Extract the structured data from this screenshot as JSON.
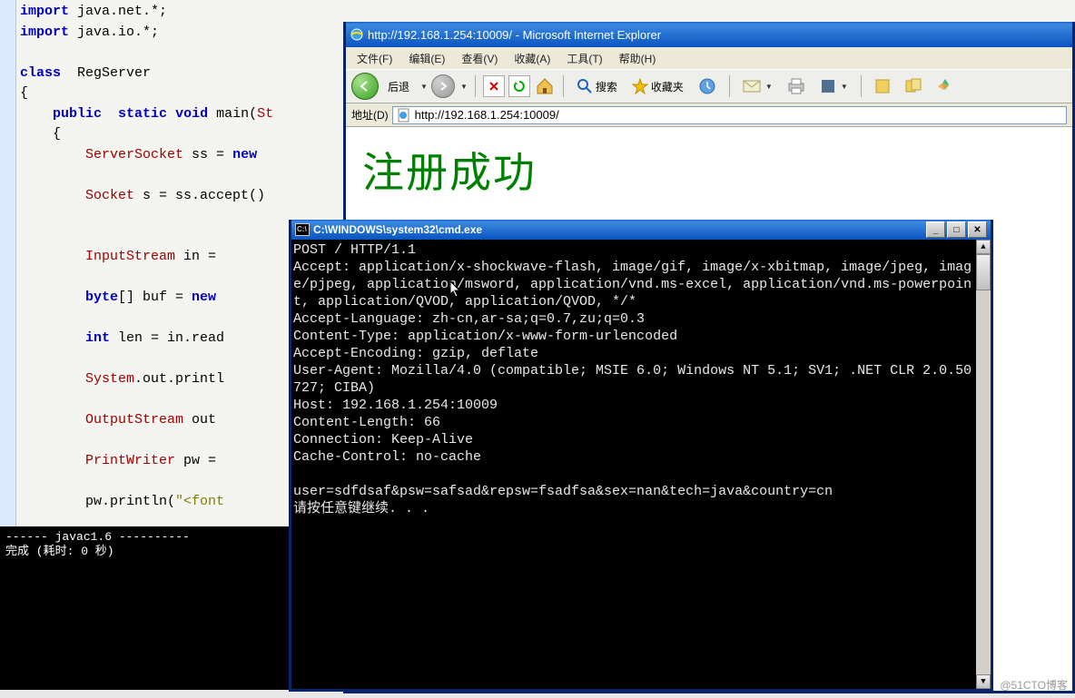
{
  "editor": {
    "code_tokens": [
      [
        [
          "kw",
          "import"
        ],
        [
          "pkg",
          " java.net.*;"
        ]
      ],
      [
        [
          "kw",
          "import"
        ],
        [
          "pkg",
          " java.io.*;"
        ]
      ],
      [],
      [
        [
          "kw",
          "class"
        ],
        [
          "ident",
          "  RegServer"
        ]
      ],
      [
        [
          "ident",
          "{"
        ]
      ],
      [
        [
          "ident",
          "    "
        ],
        [
          "kw",
          "public"
        ],
        [
          "ident",
          "  "
        ],
        [
          "kw",
          "static"
        ],
        [
          "ident",
          " "
        ],
        [
          "kw",
          "void"
        ],
        [
          "ident",
          " main("
        ],
        [
          "cls",
          "St"
        ]
      ],
      [
        [
          "ident",
          "    {"
        ]
      ],
      [
        [
          "ident",
          "        "
        ],
        [
          "cls",
          "ServerSocket"
        ],
        [
          "ident",
          " ss = "
        ],
        [
          "kw",
          "new"
        ]
      ],
      [],
      [
        [
          "ident",
          "        "
        ],
        [
          "cls",
          "Socket"
        ],
        [
          "ident",
          " s = ss.accept()"
        ]
      ],
      [],
      [],
      [
        [
          "ident",
          "        "
        ],
        [
          "cls",
          "InputStream"
        ],
        [
          "ident",
          " in = "
        ]
      ],
      [],
      [
        [
          "ident",
          "        "
        ],
        [
          "kw",
          "byte"
        ],
        [
          "ident",
          "[] buf = "
        ],
        [
          "kw",
          "new"
        ]
      ],
      [],
      [
        [
          "ident",
          "        "
        ],
        [
          "kw",
          "int"
        ],
        [
          "ident",
          " len = in.read"
        ]
      ],
      [],
      [
        [
          "ident",
          "        "
        ],
        [
          "cls",
          "System"
        ],
        [
          "ident",
          ".out.printl"
        ]
      ],
      [],
      [
        [
          "ident",
          "        "
        ],
        [
          "cls",
          "OutputStream"
        ],
        [
          "ident",
          " out "
        ]
      ],
      [],
      [
        [
          "ident",
          "        "
        ],
        [
          "cls",
          "PrintWriter"
        ],
        [
          "ident",
          " pw = "
        ]
      ],
      [],
      [
        [
          "ident",
          "        pw.println("
        ],
        [
          "str",
          "\"<font"
        ]
      ]
    ]
  },
  "compile": {
    "line1": "------ javac1.6 ----------",
    "line2": "完成 (耗时: 0 秒)"
  },
  "ie": {
    "title": "http://192.168.1.254:10009/ - Microsoft Internet Explorer",
    "menu": {
      "file": "文件(F)",
      "edit": "编辑(E)",
      "view": "查看(V)",
      "favorites": "收藏(A)",
      "tools": "工具(T)",
      "help": "帮助(H)"
    },
    "toolbar": {
      "back": "后退",
      "search": "搜索",
      "favorites": "收藏夹"
    },
    "address_label": "地址(D)",
    "address_value": "http://192.168.1.254:10009/",
    "page_text": "注册成功"
  },
  "cmd": {
    "title": "C:\\WINDOWS\\system32\\cmd.exe",
    "lines": [
      "POST / HTTP/1.1",
      "Accept: application/x-shockwave-flash, image/gif, image/x-xbitmap, image/jpeg, image/pjpeg, application/msword, application/vnd.ms-excel, application/vnd.ms-powerpoint, application/QVOD, application/QVOD, */*",
      "Accept-Language: zh-cn,ar-sa;q=0.7,zu;q=0.3",
      "Content-Type: application/x-www-form-urlencoded",
      "Accept-Encoding: gzip, deflate",
      "User-Agent: Mozilla/4.0 (compatible; MSIE 6.0; Windows NT 5.1; SV1; .NET CLR 2.0.50727; CIBA)",
      "Host: 192.168.1.254:10009",
      "Content-Length: 66",
      "Connection: Keep-Alive",
      "Cache-Control: no-cache",
      "",
      "user=sdfdsaf&psw=safsad&repsw=fsadfsa&sex=nan&tech=java&country=cn",
      "请按任意键继续. . ."
    ]
  },
  "watermark": "@51CTO博客"
}
